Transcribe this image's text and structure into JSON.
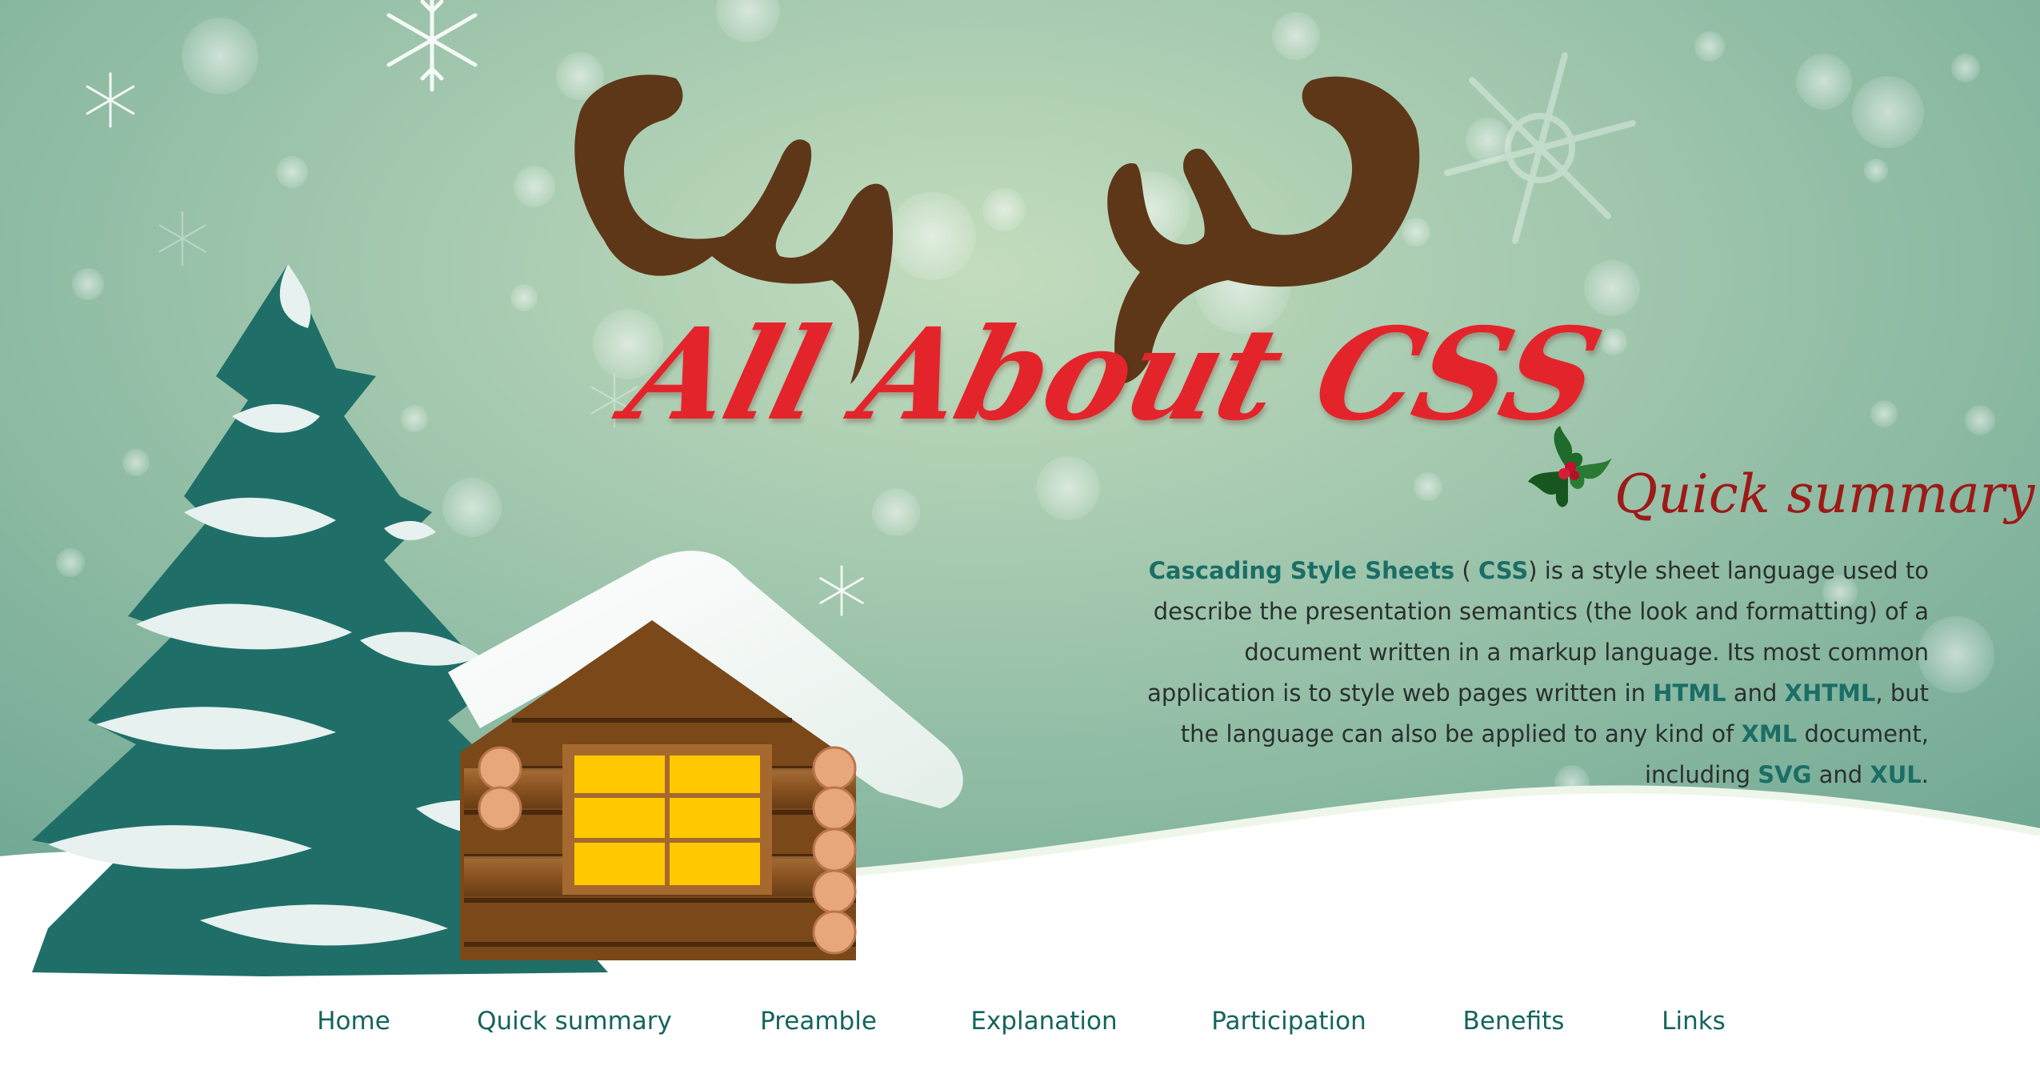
{
  "site": {
    "title": "All About CSS"
  },
  "summary": {
    "heading": "Quick summary",
    "segments": [
      {
        "text": "Cascading Style Sheets",
        "link": true
      },
      {
        "text": " ( ",
        "link": false
      },
      {
        "text": "CSS",
        "link": true
      },
      {
        "text": ") is a style sheet language used to describe the presentation semantics (the look and formatting) of a document written in a markup language. Its most common application is to style web pages written in ",
        "link": false
      },
      {
        "text": "HTML",
        "link": true
      },
      {
        "text": " and ",
        "link": false
      },
      {
        "text": "XHTML",
        "link": true
      },
      {
        "text": ", but the language can also be applied to any kind of ",
        "link": false
      },
      {
        "text": "XML",
        "link": true
      },
      {
        "text": " document, including ",
        "link": false
      },
      {
        "text": "SVG",
        "link": true
      },
      {
        "text": " and ",
        "link": false
      },
      {
        "text": "XUL",
        "link": true
      },
      {
        "text": ".",
        "link": false
      }
    ]
  },
  "nav": {
    "items": [
      {
        "label": "Home",
        "name": "nav-home"
      },
      {
        "label": "Quick summary",
        "name": "nav-quick-summary"
      },
      {
        "label": "Preamble",
        "name": "nav-preamble"
      },
      {
        "label": "Explanation",
        "name": "nav-explanation"
      },
      {
        "label": "Participation",
        "name": "nav-participation"
      },
      {
        "label": "Benefits",
        "name": "nav-benefits"
      },
      {
        "label": "Links",
        "name": "nav-links"
      }
    ]
  },
  "theme": {
    "sky": "#9ec5ac",
    "title_red": "#e3242b",
    "heading_red": "#9c1a17",
    "link_teal": "#1b6e66",
    "antler_brown": "#5e3718",
    "tree_green": "#1f6f68",
    "window_yellow": "#ffc800"
  },
  "icons": {
    "heading_icon": "holly-icon",
    "decorations": [
      "snowflake-icon",
      "antlers-icon",
      "pine-tree-icon",
      "log-cabin-icon"
    ]
  }
}
